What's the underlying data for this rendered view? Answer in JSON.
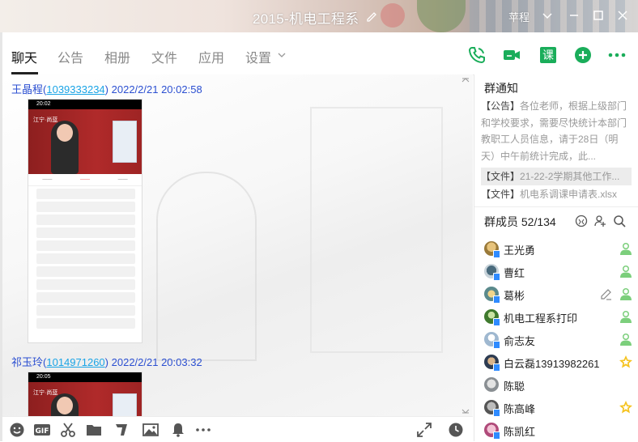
{
  "window": {
    "title": "2015-机电工程系",
    "user_label": "苹程"
  },
  "tabs": [
    {
      "label": "聊天",
      "active": true
    },
    {
      "label": "公告",
      "active": false
    },
    {
      "label": "相册",
      "active": false
    },
    {
      "label": "文件",
      "active": false
    },
    {
      "label": "应用",
      "active": false
    },
    {
      "label": "设置",
      "active": false
    }
  ],
  "toolbar_icons": [
    "phone-icon",
    "video-call-icon",
    "lesson-icon",
    "add-icon",
    "more-icon"
  ],
  "lesson_label": "课",
  "messages": [
    {
      "sender": "王晶程",
      "qq": "1039333234",
      "time": "2022/2/21 20:02:58",
      "phone_time": "20:02",
      "banner_tag": "江宁·尚蓝"
    },
    {
      "sender": "祁玉玲",
      "qq": "1014971260",
      "time": "2022/2/21 20:03:32",
      "phone_time": "20:05",
      "banner_tag": "江宁·尚蓝"
    }
  ],
  "notice": {
    "title": "群通知",
    "announcement_tag": "【公告】",
    "announcement_text": "各位老师，根据上级部门和学校要求，需要尽快统计本部门教职工人员信息，请于28日（明天）中午前统计完成，此...",
    "files": [
      {
        "tag": "【文件】",
        "name": "21-22-2学期其他工作..."
      },
      {
        "tag": "【文件】",
        "name": "机电系调课申请表.xlsx"
      }
    ]
  },
  "members": {
    "title": "群成员 52/134",
    "list": [
      {
        "name": "王光勇",
        "role": "admin"
      },
      {
        "name": "曹红",
        "role": "admin"
      },
      {
        "name": "葛彬",
        "role": "admin"
      },
      {
        "name": "机电工程系打印",
        "role": "admin"
      },
      {
        "name": "俞志友",
        "role": "admin"
      },
      {
        "name": "白云磊13913982261",
        "role": "owner"
      },
      {
        "name": "陈聪",
        "role": ""
      },
      {
        "name": "陈高峰",
        "role": "owner"
      },
      {
        "name": "陈凯红",
        "role": ""
      }
    ]
  },
  "colors": {
    "accent_green": "#1aad5a",
    "link_blue": "#2b4fd1",
    "qq_blue": "#1aa4e6",
    "owner_gold": "#f5c320"
  }
}
